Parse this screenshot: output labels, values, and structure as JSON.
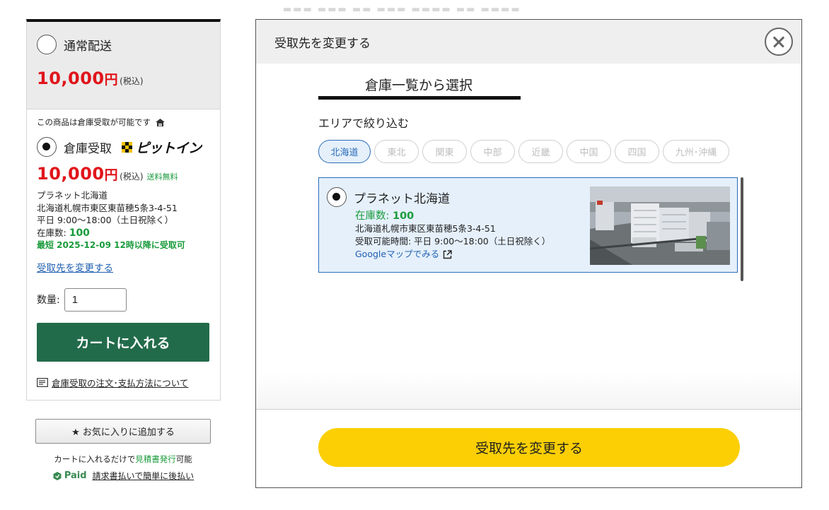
{
  "left_panel": {
    "normal_delivery": {
      "label": "通常配送",
      "price": "10,000",
      "yen": "円",
      "tax": "(税込)"
    },
    "warehouse": {
      "note": "この商品は倉庫受取が可能です",
      "label": "倉庫受取",
      "logo_text": "ピットイン",
      "price": "10,000",
      "yen": "円",
      "tax": "(税込)",
      "free_shipping": "送料無料",
      "name": "プラネット北海道",
      "address": "北海道札幌市東区東苗穂5条3-4-51",
      "hours": "平日 9:00～18:00（土日祝除く）",
      "stock_label": "在庫数:",
      "stock_value": "100",
      "earliest": "最短 2025-12-09 12時以降に受取可",
      "change_link": "受取先を変更する"
    },
    "quantity_label": "数量:",
    "quantity_value": "1",
    "cart_button": "カートに入れる",
    "order_info_link": "倉庫受取の注文･支払方法について"
  },
  "below_card": {
    "favorite_button": "★ お気に入りに追加する",
    "quote_prefix": "カートに入れるだけで",
    "quote_link": "見積書発行",
    "quote_suffix": "可能",
    "paid_logo": "Paid",
    "paid_text": "請求書払いで簡単に後払い"
  },
  "modal": {
    "title": "受取先を変更する",
    "tab_title": "倉庫一覧から選択",
    "area_label": "エリアで絞り込む",
    "areas": [
      "北海道",
      "東北",
      "関東",
      "中部",
      "近畿",
      "中国",
      "四国",
      "九州･沖縄"
    ],
    "selected_area": "北海道",
    "warehouse_card": {
      "name": "プラネット北海道",
      "stock_label": "在庫数:",
      "stock_value": "100",
      "address": "北海道札幌市東区東苗穂5条3-4-51",
      "hours": "受取可能時間: 平日 9:00～18:00（土日祝除く）",
      "map_link": "Googleマップでみる"
    },
    "submit_button": "受取先を変更する"
  },
  "colors": {
    "price_red": "#e0151b",
    "green": "#1a9b3c",
    "cart_green": "#226b4a",
    "link_blue": "#1f5fb0",
    "chip_blue": "#2b6cb8",
    "submit_yellow": "#fbcf03"
  }
}
